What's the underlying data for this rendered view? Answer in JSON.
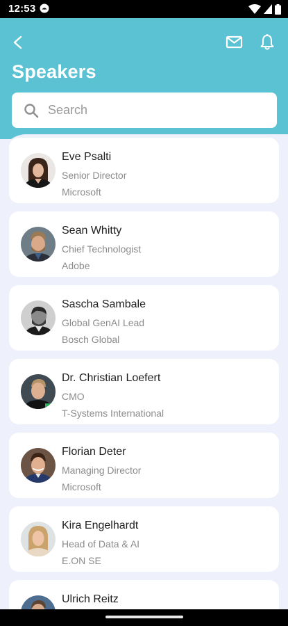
{
  "status_bar": {
    "time": "12:53"
  },
  "header": {
    "title": "Speakers"
  },
  "search": {
    "placeholder": "Search"
  },
  "speakers": [
    {
      "name": "Eve Psalti",
      "role": "Senior Director",
      "company": "Microsoft"
    },
    {
      "name": "Sean Whitty",
      "role": "Chief Technologist",
      "company": "Adobe"
    },
    {
      "name": "Sascha Sambale",
      "role": "Global GenAI Lead",
      "company": "Bosch Global"
    },
    {
      "name": "Dr. Christian Loefert",
      "role": "CMO",
      "company": "T-Systems International"
    },
    {
      "name": "Florian Deter",
      "role": "Managing Director",
      "company": "Microsoft"
    },
    {
      "name": "Kira Engelhardt",
      "role": "Head of Data & AI",
      "company": "E.ON SE"
    },
    {
      "name": "Ulrich Reitz",
      "role": "",
      "company": ""
    }
  ],
  "colors": {
    "header_bg": "#5bc2d3",
    "list_bg": "#eef1fb",
    "card_bg": "#ffffff",
    "name_text": "#1e1e1e",
    "secondary_text": "#8b8b8b"
  }
}
